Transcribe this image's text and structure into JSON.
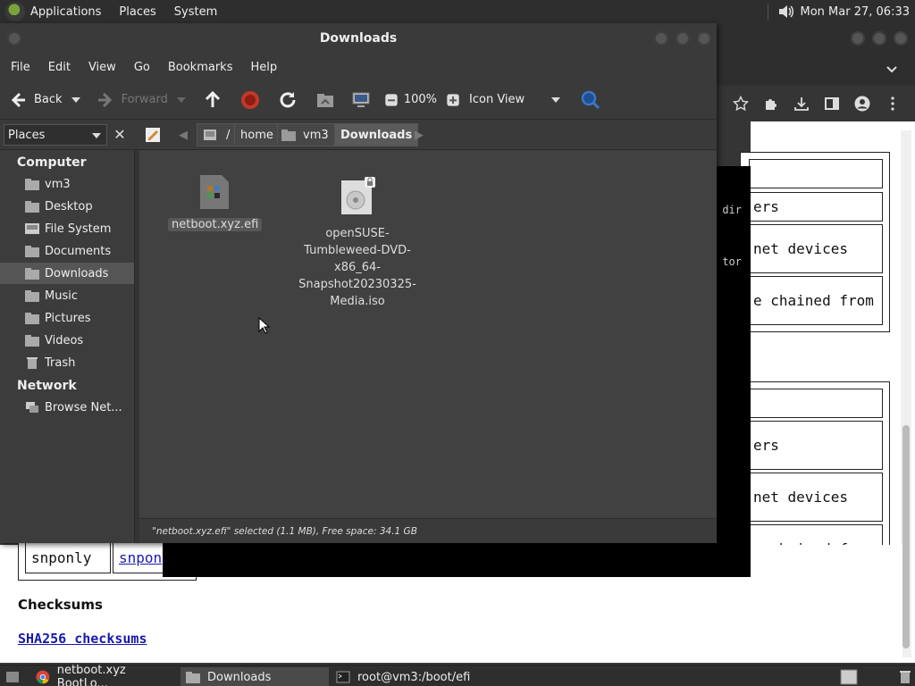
{
  "top_panel": {
    "menus": [
      "Applications",
      "Places",
      "System"
    ],
    "clock": "Mon Mar 27, 06:33"
  },
  "file_manager": {
    "window_title": "Downloads",
    "menubar": [
      "File",
      "Edit",
      "View",
      "Go",
      "Bookmarks",
      "Help"
    ],
    "toolbar": {
      "back_label": "Back",
      "forward_label": "Forward",
      "zoom_level": "100%",
      "view_mode": "Icon View"
    },
    "sidebar_selector": "Places",
    "path": {
      "root": "/",
      "crumbs": [
        "home",
        "vm3",
        "Downloads"
      ]
    },
    "sidebar": {
      "computer_header": "Computer",
      "computer_items": [
        "vm3",
        "Desktop",
        "File System",
        "Documents",
        "Downloads",
        "Music",
        "Pictures",
        "Videos",
        "Trash"
      ],
      "network_header": "Network",
      "network_items": [
        "Browse Net..."
      ],
      "selected": "Downloads"
    },
    "files": [
      {
        "name": "netboot.xyz.efi",
        "selected": true
      },
      {
        "name_lines": [
          "openSUSE-",
          "Tumbleweed-DVD-",
          "x86_64-",
          "Snapshot20230325-",
          "Media.iso"
        ],
        "selected": false
      }
    ],
    "status": "\"netboot.xyz.efi\" selected (1.1 MB), Free space: 34.1 GB"
  },
  "terminal": {
    "fragments": [
      "dir",
      "tor"
    ]
  },
  "webpage": {
    "cells": [
      "ers",
      "net devices",
      "e chained from",
      "ers",
      "net devices",
      "e chained from"
    ],
    "table_row_left": "snponly",
    "table_row_link": "snpon",
    "heading": "Checksums",
    "link": "SHA256 checksums"
  },
  "taskbar": {
    "tasks": [
      "netboot.xyz BootLo...",
      "Downloads",
      "root@vm3:/boot/efi"
    ]
  }
}
